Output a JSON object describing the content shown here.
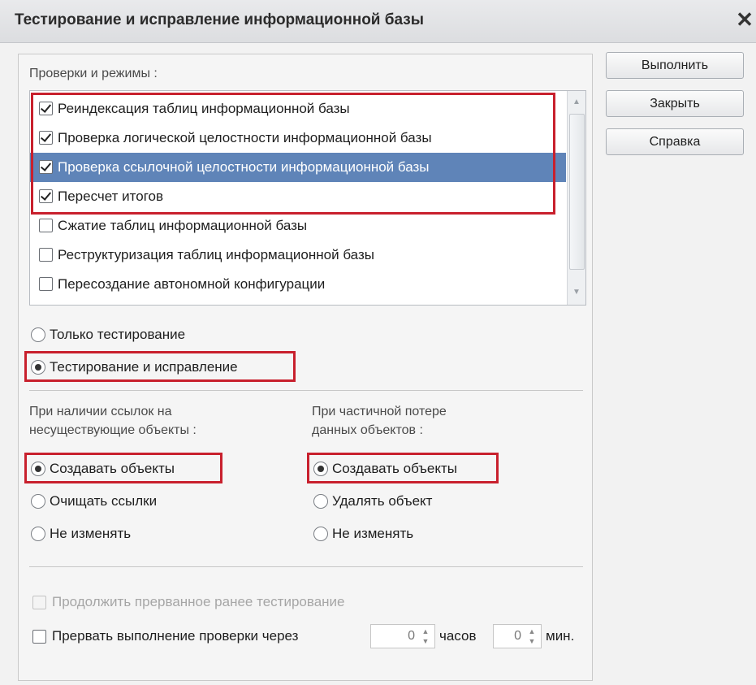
{
  "window": {
    "title": "Тестирование и исправление информационной базы",
    "close_glyph": "✕"
  },
  "checks": {
    "label": "Проверки и режимы :",
    "items": [
      {
        "label": "Реиндексация таблиц информационной базы",
        "checked": true
      },
      {
        "label": "Проверка логической целостности информационной базы",
        "checked": true
      },
      {
        "label": "Проверка ссылочной целостности информационной базы",
        "checked": true,
        "selected": true
      },
      {
        "label": "Пересчет итогов",
        "checked": true
      },
      {
        "label": "Сжатие таблиц информационной базы",
        "checked": false
      },
      {
        "label": "Реструктуризация таблиц информационной базы",
        "checked": false
      },
      {
        "label": "Пересоздание автономной конфигурации",
        "checked": false
      }
    ]
  },
  "mode": {
    "options": [
      {
        "label": "Только тестирование",
        "selected": false
      },
      {
        "label": "Тестирование и исправление",
        "selected": true
      }
    ]
  },
  "missing_refs": {
    "label_line1": "При наличии ссылок на",
    "label_line2": "несуществующие объекты :",
    "options": [
      {
        "label": "Создавать объекты",
        "selected": true
      },
      {
        "label": "Очищать ссылки",
        "selected": false
      },
      {
        "label": "Не изменять",
        "selected": false
      }
    ]
  },
  "partial_loss": {
    "label_line1": "При частичной потере",
    "label_line2": "данных объектов :",
    "options": [
      {
        "label": "Создавать объекты",
        "selected": true
      },
      {
        "label": "Удалять объект",
        "selected": false
      },
      {
        "label": "Не изменять",
        "selected": false
      }
    ]
  },
  "continue_test": {
    "label": "Продолжить прерванное ранее тестирование",
    "checked": false,
    "disabled": true
  },
  "interrupt": {
    "label": "Прервать выполнение проверки через",
    "checked": false,
    "hours_value": "0",
    "hours_label": "часов",
    "minutes_value": "0",
    "minutes_label": "мин."
  },
  "buttons": {
    "run": "Выполнить",
    "close": "Закрыть",
    "help": "Справка"
  },
  "colors": {
    "highlight_red": "#c8202d",
    "selection_blue": "#5f84b8"
  },
  "icons": {
    "spin_up": "▲",
    "spin_down": "▼",
    "scroll_up": "▲",
    "scroll_down": "▼"
  }
}
